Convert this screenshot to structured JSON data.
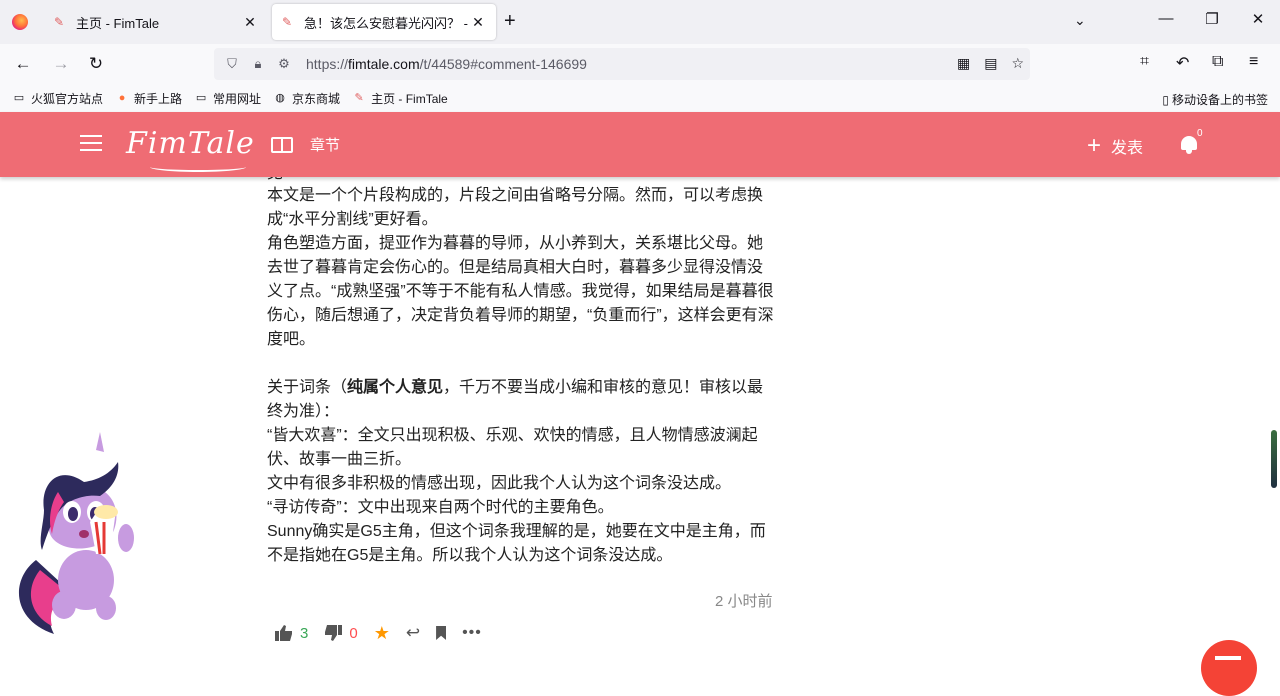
{
  "browser": {
    "tabs": [
      {
        "title": "主页 - FimTale",
        "close": "✕"
      },
      {
        "title": "急！该怎么安慰暮光闪闪？ - Fi",
        "close": "✕"
      }
    ],
    "new_tab": "+",
    "list_all_tabs": "⌄",
    "window": {
      "minimize": "—",
      "maximize": "❐",
      "close": "✕"
    },
    "nav": {
      "back": "←",
      "forward": "→",
      "reload": "↻"
    },
    "url_prefix": "https://",
    "url_host": "fimtale.com",
    "url_path": "/t/44589#comment-146699",
    "bookmarks": [
      {
        "label": "火狐官方站点",
        "icon": "folder-icon"
      },
      {
        "label": "新手上路",
        "icon": "firefox-icon"
      },
      {
        "label": "常用网址",
        "icon": "folder-icon"
      },
      {
        "label": "京东商城",
        "icon": "globe-icon"
      },
      {
        "label": "主页 - FimTale",
        "icon": "fimtale-icon"
      }
    ],
    "mobile_bookmarks": "移动设备上的书签"
  },
  "site": {
    "logo": "FimTale",
    "chapters": "章节",
    "publish": "发表",
    "notification_count": "0"
  },
  "comment": {
    "cut_line": "见",
    "paragraphs": [
      "本文是一个个片段构成的，片段之间由省略号分隔。然而，可以考虑换成“水平分割线”更好看。",
      "角色塑造方面，提亚作为暮暮的导师，从小养到大，关系堪比父母。她去世了暮暮肯定会伤心的。但是结局真相大白时，暮暮多少显得没情没义了点。“成熟坚强”不等于不能有私人情感。我觉得，如果结局是暮暮很伤心，随后想通了，决定背负着导师的期望，“负重而行”，这样会更有深度吧。"
    ],
    "terms_before": "关于词条（",
    "terms_bold": "纯属个人意见",
    "terms_after": "，千万不要当成小编和审核的意见！审核以最终为准）：",
    "paragraphs2": [
      "“皆大欢喜”：全文只出现积极、乐观、欢快的情感，且人物情感波澜起伏、故事一曲三折。",
      "文中有很多非积极的情感出现，因此我个人认为这个词条没达成。",
      "“寻访传奇”：文中出现来自两个时代的主要角色。",
      "Sunny确实是G5主角，但这个词条我理解的是，她要在文中是主角，而不是指她在G5是主角。所以我个人认为这个词条没达成。"
    ],
    "time": "2 小时前",
    "upvotes": "3",
    "downvotes": "0"
  },
  "colors": {
    "brand": "#ef6c74",
    "upvote": "#3aa757",
    "downvote": "#ff4d4f",
    "star": "#ff9800",
    "fab": "#f44336"
  }
}
